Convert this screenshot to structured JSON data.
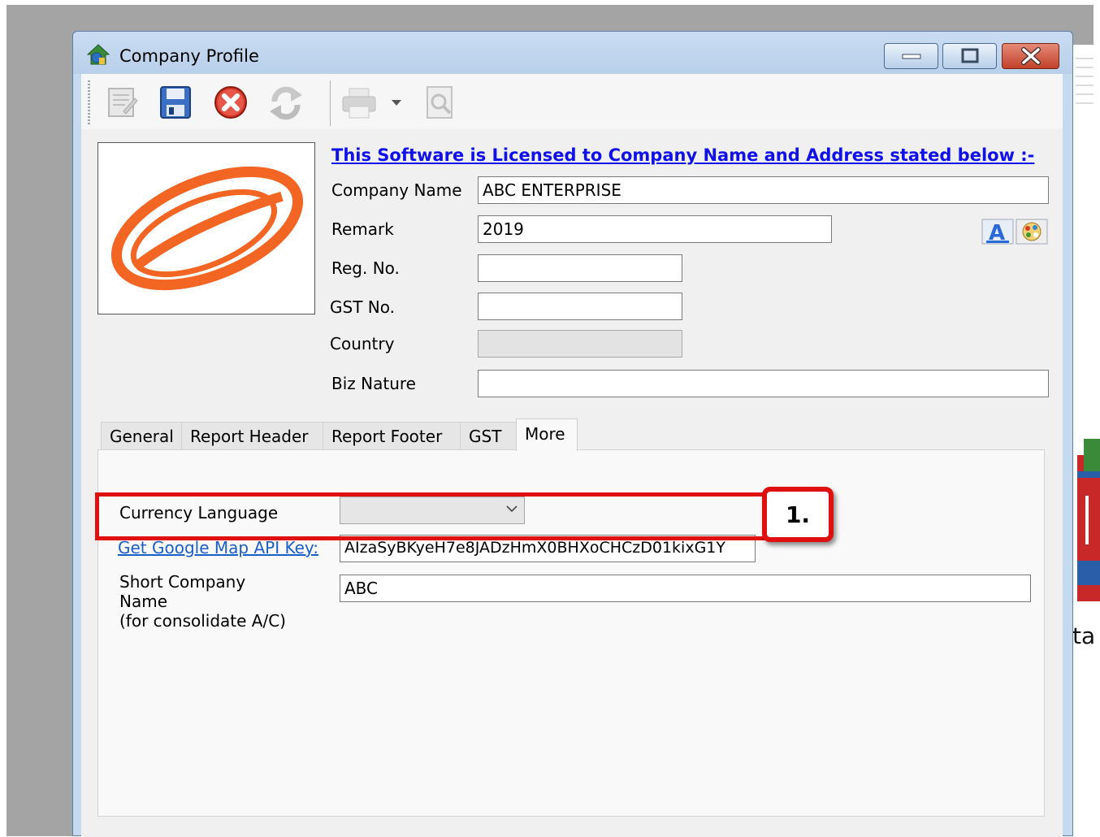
{
  "window": {
    "title": "Company Profile"
  },
  "license_notice": "This Software is Licensed to Company Name and Address stated below :-",
  "fields": {
    "company_name": {
      "label": "Company Name",
      "value": "ABC ENTERPRISE"
    },
    "remark": {
      "label": "Remark",
      "value": "2019"
    },
    "reg_no": {
      "label": "Reg. No.",
      "value": ""
    },
    "gst_no": {
      "label": "GST No.",
      "value": ""
    },
    "country": {
      "label": "Country",
      "value": ""
    },
    "biz_nature": {
      "label": "Biz Nature",
      "value": ""
    }
  },
  "tabs": [
    "General",
    "Report Header",
    "Report Footer",
    "GST",
    "More"
  ],
  "active_tab": "More",
  "more_tab": {
    "currency_language": {
      "label": "Currency Language",
      "value": ""
    },
    "google_map_key": {
      "link_label": "Get Google Map API Key:",
      "value": "AIzaSyBKyeH7e8JADzHmX0BHXoCHCzD01kixG1Y"
    },
    "short_company_name": {
      "label_line1": "Short Company",
      "label_line2": "Name",
      "label_line3": "(for consolidate A/C)",
      "value": "ABC"
    }
  },
  "annotation": {
    "callout_label": "1."
  },
  "background_text": "ta",
  "colors": {
    "link": "#1010e8",
    "annotation": "#e01010",
    "logo": "#f26522"
  },
  "icons": [
    "house-icon",
    "edit-icon",
    "save-icon",
    "cancel-icon",
    "refresh-icon",
    "print-icon",
    "dropdown-arrow-icon",
    "preview-icon",
    "font-icon",
    "color-icon",
    "minimize-icon",
    "maximize-icon",
    "close-icon",
    "chevron-down-icon"
  ]
}
